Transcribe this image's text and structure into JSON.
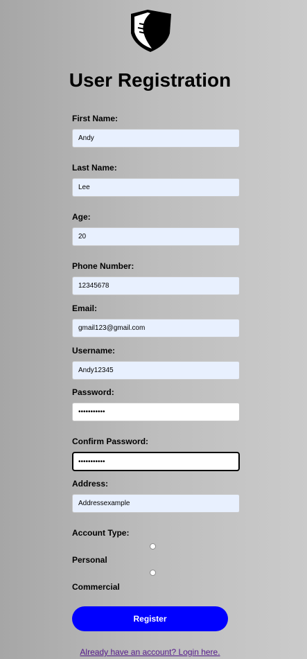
{
  "page": {
    "title": "User Registration"
  },
  "form": {
    "first_name": {
      "label": "First Name:",
      "value": "Andy"
    },
    "last_name": {
      "label": "Last Name:",
      "value": "Lee"
    },
    "age": {
      "label": "Age:",
      "value": "20"
    },
    "phone": {
      "label": "Phone Number:",
      "value": "12345678"
    },
    "email": {
      "label": "Email:",
      "value": "gmail123@gmail.com"
    },
    "username": {
      "label": "Username:",
      "value": "Andy12345"
    },
    "password": {
      "label": "Password:",
      "value": "•••••••••••"
    },
    "confirm_password": {
      "label": "Confirm Password:",
      "value": "•••••••••••"
    },
    "address": {
      "label": "Address:",
      "value": "Addressexample"
    },
    "account_type": {
      "label": "Account Type:",
      "options": [
        "Personal",
        "Commercial"
      ]
    },
    "register_label": "Register",
    "login_link": "Already have an account? Login here."
  },
  "colors": {
    "button": "#0000ff",
    "autofill_bg": "#e8f0fe",
    "link": "#551a8b"
  },
  "icons": {
    "logo": "shield-fin-logo-icon"
  }
}
